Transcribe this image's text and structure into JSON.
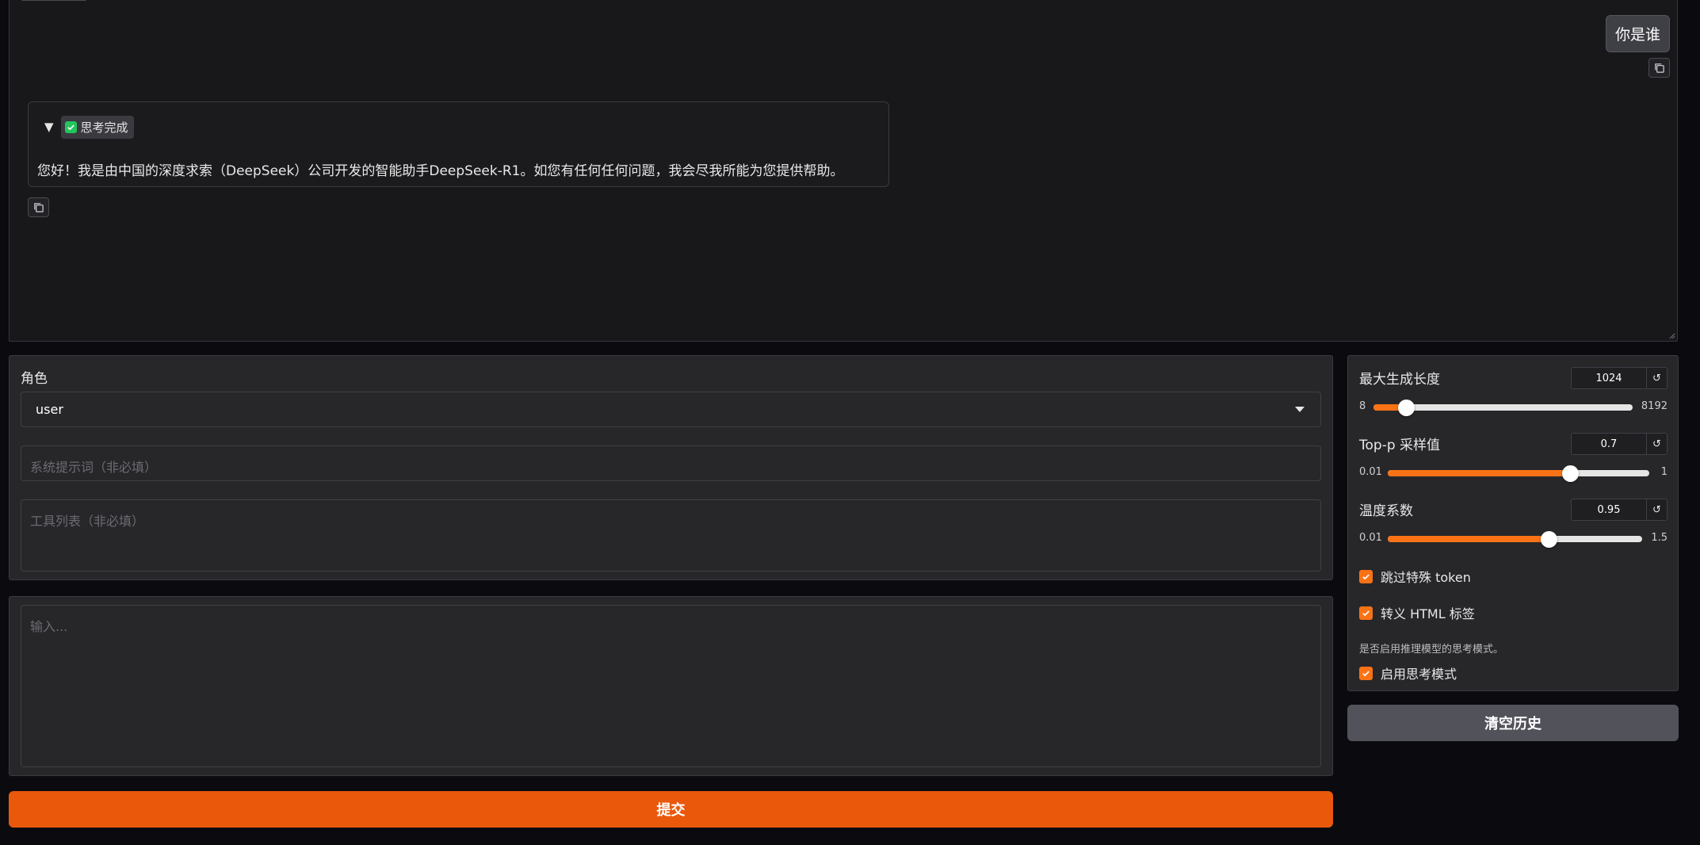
{
  "chat": {
    "user_message": "你是谁",
    "assistant": {
      "thinking_badge": "思考完成",
      "message": "您好！我是由中国的深度求索（DeepSeek）公司开发的智能助手DeepSeek-R1。如您有任何任何问题，我会尽我所能为您提供帮助。"
    }
  },
  "form": {
    "role_label": "角色",
    "role_value": "user",
    "system_placeholder": "系统提示词（非必填）",
    "tools_placeholder": "工具列表（非必填）",
    "input_placeholder": "输入...",
    "submit_label": "提交"
  },
  "settings": {
    "max_length": {
      "label": "最大生成长度",
      "value": "1024",
      "min": "8",
      "max": "8192",
      "fraction": 0.124
    },
    "top_p": {
      "label": "Top-p 采样值",
      "value": "0.7",
      "min": "0.01",
      "max": "1",
      "fraction": 0.697
    },
    "temperature": {
      "label": "温度系数",
      "value": "0.95",
      "min": "0.01",
      "max": "1.5",
      "fraction": 0.631
    },
    "skip_special_tokens": {
      "label": "跳过特殊 token",
      "checked": true
    },
    "escape_html": {
      "label": "转义 HTML 标签",
      "checked": true
    },
    "thinking_hint": "是否启用推理模型的思考模式。",
    "enable_thinking": {
      "label": "启用思考模式",
      "checked": true
    },
    "clear_label": "清空历史"
  },
  "icons": {
    "copy": "copy-icon",
    "disclosure": "triangle-down-icon",
    "done": "check-box-icon",
    "dropdown": "caret-down-icon",
    "reset": "reset-icon"
  },
  "colors": {
    "accent": "#ea580c",
    "slider_fill": "#f97316",
    "done_green": "#22c55e",
    "panel_bg": "#27272a",
    "page_bg": "#0b0b0f"
  }
}
